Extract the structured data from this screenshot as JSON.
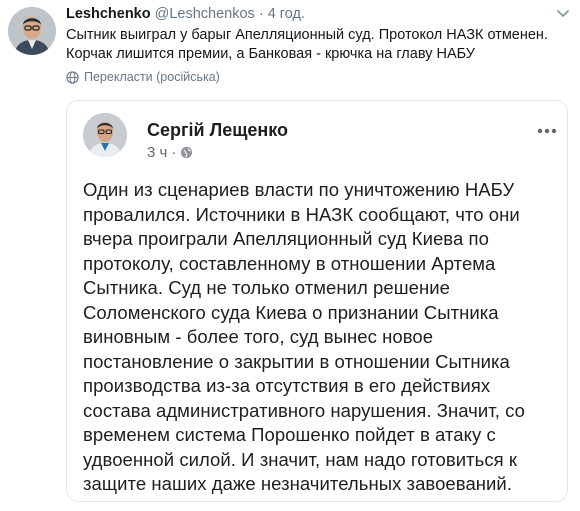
{
  "tweet": {
    "display_name": "Leshchenko",
    "handle": "@Leshchenkos",
    "separator": "·",
    "time": "4 год.",
    "text_lines": [
      "Сытник выиграл у барыг Апелляционный суд. Протокол НАЗК отменен.",
      "Корчак лишится премии, а Банковая - крючка на главу НАБУ"
    ],
    "translate_label": "Перекласти (російська)",
    "icons": {
      "translate": "globe-icon",
      "menu": "chevron-down-icon"
    }
  },
  "quoted_post": {
    "author": "Сергій Лещенко",
    "time": "3 ч",
    "separator": "·",
    "icons": {
      "audience": "globe-icon",
      "more": "more-dots-icon"
    },
    "body_lines": [
      "Один из сценариев власти по уничтожению НАБУ",
      "провалился. Источники в НАЗК сообщают, что они",
      "вчера проиграли Апелляционный суд Киева по",
      "протоколу, составленному в отношении Артема",
      "Сытника. Суд не только отменил решение",
      "Соломенского суда Киева о признании Сытника",
      "виновным - более того, суд вынес новое",
      "постановление о закрытии в отношении Сытника",
      "производства из-за отсутствия в его действиях",
      "состава административного нарушения. Значит, со",
      "временем система Порошенко пойдет в атаку с",
      "удвоенной силой. И значит, нам надо готовиться к",
      "защите наших даже незначительных завоеваний."
    ]
  }
}
